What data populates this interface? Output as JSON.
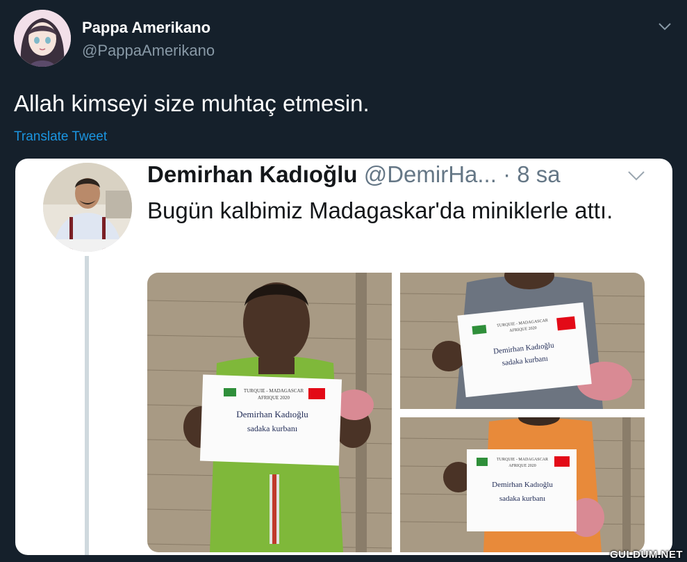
{
  "tweet": {
    "author_name": "Pappa Amerikano",
    "author_handle": "@PappaAmerikano",
    "text": "Allah kimseyi size muhtaç etmesin.",
    "translate_label": "Translate Tweet"
  },
  "quoted_tweet": {
    "author_name": "Demirhan Kadıoğlu",
    "author_handle": "@DemirHa...",
    "time": "· 8 sa",
    "text": "Bugün kalbimiz Madagaskar'da miniklerle attı."
  },
  "photos": {
    "sign_header_line1": "TURQUIE - MADAGASCAR",
    "sign_header_line2": "AFRIQUE 2020",
    "sign_name": "Demirhan Kadıoğlu",
    "sign_subtitle": "sadaka kurbanı"
  },
  "watermark": "GULDUM.NET",
  "colors": {
    "background": "#15202b",
    "card": "#ffffff",
    "link": "#1b95e0",
    "muted": "#8899a6"
  }
}
